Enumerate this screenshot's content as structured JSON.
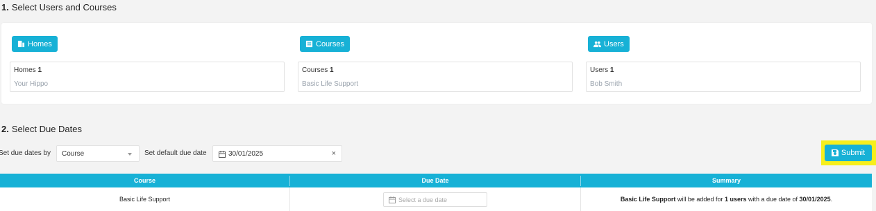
{
  "section1": {
    "number": "1.",
    "title": "Select Users and Courses"
  },
  "section2": {
    "number": "2.",
    "title": "Select Due Dates"
  },
  "selectors": [
    {
      "button_label": "Homes",
      "icon": "building-icon",
      "header_label": "Homes",
      "count": "1",
      "value": "Your Hippo"
    },
    {
      "button_label": "Courses",
      "icon": "book-icon",
      "header_label": "Courses",
      "count": "1",
      "value": "Basic Life Support"
    },
    {
      "button_label": "Users",
      "icon": "users-icon",
      "header_label": "Users",
      "count": "1",
      "value": "Bob Smith"
    }
  ],
  "controls": {
    "set_by_label": "Set due dates by",
    "set_by_value": "Course",
    "default_date_label": "Set default due date",
    "default_date_value": "30/01/2025",
    "clear_symbol": "×",
    "submit_label": "Submit"
  },
  "table": {
    "headers": [
      "Course",
      "Due Date",
      "Summary"
    ],
    "rows": [
      {
        "course": "Basic Life Support",
        "due_placeholder": "Select a due date",
        "summary_course": "Basic Life Support",
        "summary_mid1": " will be added for ",
        "summary_users": "1 users",
        "summary_mid2": " with a due date of ",
        "summary_date": "30/01/2025",
        "summary_end": "."
      }
    ]
  },
  "colors": {
    "accent": "#17b1d6",
    "highlight": "#f7ef1c",
    "background": "#f3f3f3"
  }
}
